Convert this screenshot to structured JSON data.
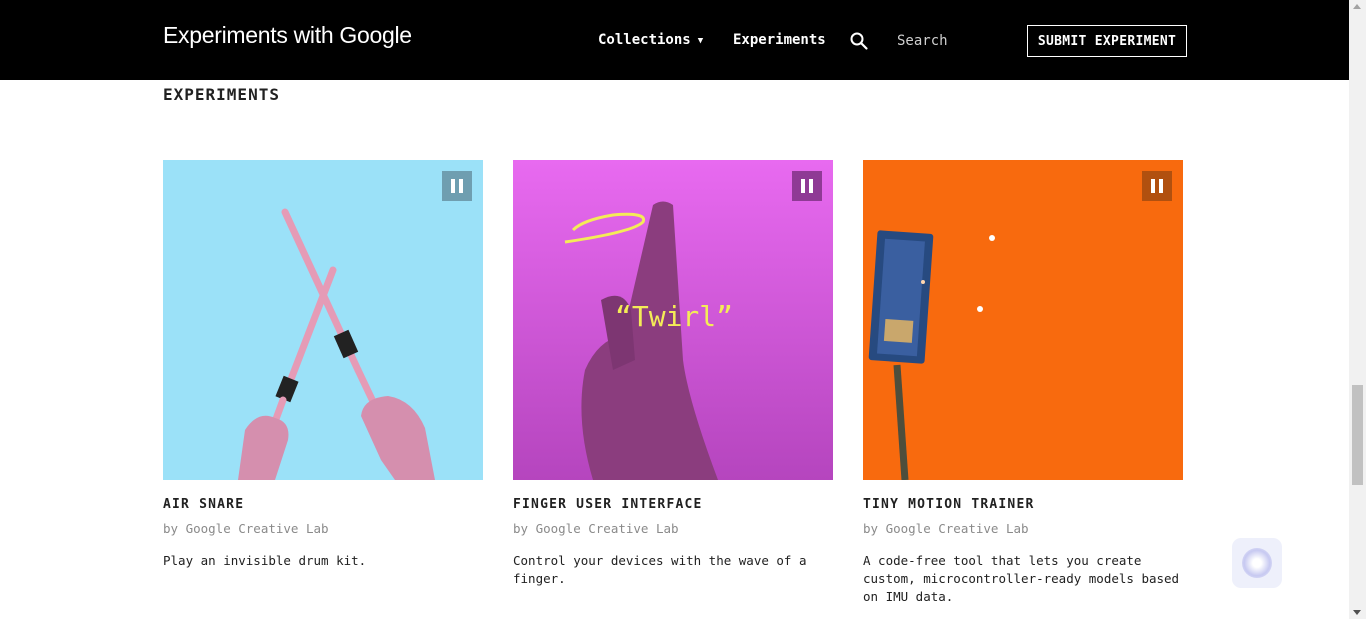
{
  "header": {
    "brand": "Experiments with Google",
    "nav": {
      "collections": "Collections",
      "experiments": "Experiments"
    },
    "search_placeholder": "Search",
    "submit_label": "SUBMIT EXPERIMENT"
  },
  "section": {
    "heading": "EXPERIMENTS"
  },
  "cards": [
    {
      "title": "AIR SNARE",
      "author": "by Google Creative Lab",
      "description": "Play an invisible drum kit.",
      "bg_color": "#9be1f8",
      "pause_color": "#6f9eb0"
    },
    {
      "title": "FINGER USER INTERFACE",
      "author": "by Google Creative Lab",
      "description": "Control your devices with the wave of a finger.",
      "overlay_text": "“Twirl”",
      "bg_color": "#d84fe0",
      "pause_color": "#8f3a95"
    },
    {
      "title": "TINY MOTION TRAINER",
      "author": "by Google Creative Lab",
      "description": "A code-free tool that lets you create custom, microcontroller-ready models based on IMU data.",
      "bg_color": "#f86a0e",
      "pause_color": "#b1500f"
    }
  ],
  "colors": {
    "header_bg": "#000000",
    "text": "#212121",
    "muted": "#8a8a8a"
  }
}
